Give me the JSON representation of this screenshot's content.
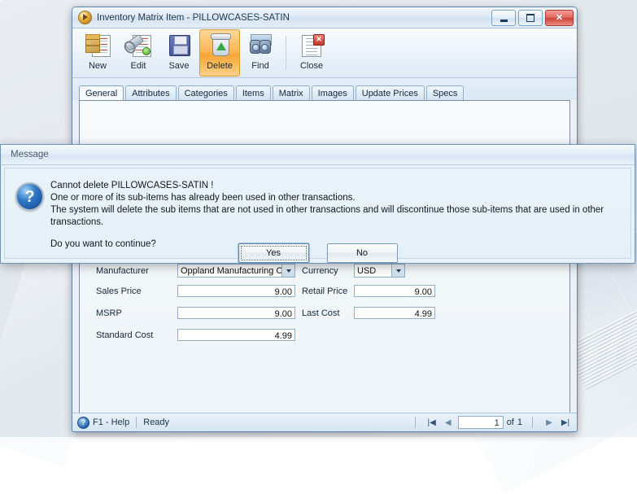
{
  "window": {
    "title": "Inventory Matrix Item - PILLOWCASES-SATIN",
    "icon": "play-circle-icon",
    "controls": {
      "minimize": "Minimize",
      "maximize": "Maximize",
      "close": "Close"
    }
  },
  "toolbar": {
    "buttons": [
      {
        "label": "New",
        "icon": "new-document-icon",
        "active": false
      },
      {
        "label": "Edit",
        "icon": "edit-wrench-icon",
        "active": false
      },
      {
        "label": "Save",
        "icon": "floppy-disk-icon",
        "active": false
      },
      {
        "label": "Delete",
        "icon": "recycle-bin-icon",
        "active": true
      },
      {
        "label": "Find",
        "icon": "binoculars-icon",
        "active": false
      },
      {
        "label": "Close",
        "icon": "close-document-icon",
        "active": false
      }
    ]
  },
  "tabs": [
    {
      "label": "General",
      "selected": true
    },
    {
      "label": "Attributes",
      "selected": false
    },
    {
      "label": "Categories",
      "selected": false
    },
    {
      "label": "Items",
      "selected": false
    },
    {
      "label": "Matrix",
      "selected": false
    },
    {
      "label": "Images",
      "selected": false
    },
    {
      "label": "Update Prices",
      "selected": false
    },
    {
      "label": "Specs",
      "selected": false
    }
  ],
  "form": {
    "manufacturer": {
      "label": "Manufacturer",
      "value": "Oppland Manufacturing Co"
    },
    "currency": {
      "label": "Currency",
      "value": "USD"
    },
    "sales_price": {
      "label": "Sales Price",
      "value": "9.00"
    },
    "retail_price": {
      "label": "Retail Price",
      "value": "9.00"
    },
    "msrp": {
      "label": "MSRP",
      "value": "9.00"
    },
    "last_cost": {
      "label": "Last Cost",
      "value": "4.99"
    },
    "standard_cost": {
      "label": "Standard Cost",
      "value": "4.99"
    }
  },
  "statusbar": {
    "help": "F1 - Help",
    "state": "Ready",
    "page": "1",
    "of": "of",
    "total": "1",
    "nav": {
      "first": "|◀",
      "prev": "◀",
      "next": "▶",
      "last": "▶|"
    }
  },
  "dialog": {
    "title": "Message",
    "icon": "question-mark-icon",
    "line1": "Cannot delete PILLOWCASES-SATIN !",
    "line2": "One or more of its sub-items has already been used in other transactions.",
    "line3": "The system will delete the sub items that are not used in other transactions and will discontinue those sub-items that are used in other transactions.",
    "prompt": "Do you want to continue?",
    "yes_label": "Yes",
    "no_label": "No"
  },
  "colors": {
    "accent": "#f8a634",
    "close": "#c94236",
    "frame": "#5b85b5"
  }
}
